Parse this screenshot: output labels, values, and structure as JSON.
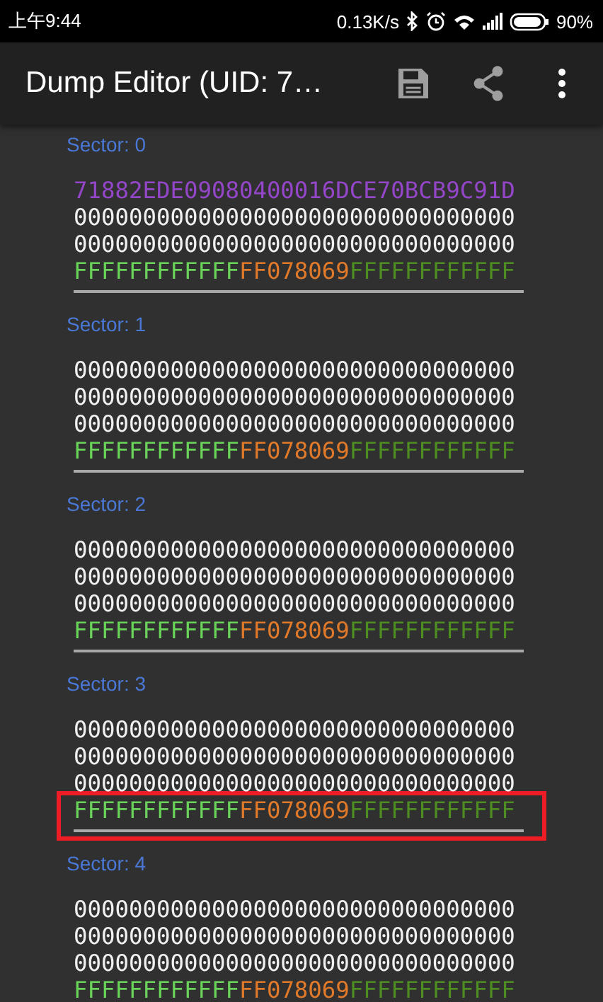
{
  "status_bar": {
    "time": "上午9:44",
    "network_speed": "0.13K/s",
    "battery": "90%"
  },
  "app_bar": {
    "title": "Dump Editor (UID: 7…"
  },
  "sectors": [
    {
      "label": "Sector: 0",
      "lines": [
        {
          "kind": "manufacturer",
          "text": "71882EDE09080400016DCE70BCB9C91D"
        },
        {
          "kind": "data",
          "text": "00000000000000000000000000000000"
        },
        {
          "kind": "data",
          "text": "00000000000000000000000000000000"
        },
        {
          "kind": "trailer",
          "key_a": "FFFFFFFFFFFF",
          "access_bits": "FF078069",
          "key_b": "FFFFFFFFFFFF",
          "highlighted": false
        }
      ]
    },
    {
      "label": "Sector: 1",
      "lines": [
        {
          "kind": "data",
          "text": "00000000000000000000000000000000"
        },
        {
          "kind": "data",
          "text": "00000000000000000000000000000000"
        },
        {
          "kind": "data",
          "text": "00000000000000000000000000000000"
        },
        {
          "kind": "trailer",
          "key_a": "FFFFFFFFFFFF",
          "access_bits": "FF078069",
          "key_b": "FFFFFFFFFFFF",
          "highlighted": false
        }
      ]
    },
    {
      "label": "Sector: 2",
      "lines": [
        {
          "kind": "data",
          "text": "00000000000000000000000000000000"
        },
        {
          "kind": "data",
          "text": "00000000000000000000000000000000"
        },
        {
          "kind": "data",
          "text": "00000000000000000000000000000000"
        },
        {
          "kind": "trailer",
          "key_a": "FFFFFFFFFFFF",
          "access_bits": "FF078069",
          "key_b": "FFFFFFFFFFFF",
          "highlighted": false
        }
      ]
    },
    {
      "label": "Sector: 3",
      "lines": [
        {
          "kind": "data",
          "text": "00000000000000000000000000000000"
        },
        {
          "kind": "data",
          "text": "00000000000000000000000000000000"
        },
        {
          "kind": "data",
          "text": "00000000000000000000000000000000"
        },
        {
          "kind": "trailer",
          "key_a": "FFFFFFFFFFFF",
          "access_bits": "FF078069",
          "key_b": "FFFFFFFFFFFF",
          "highlighted": true
        }
      ]
    },
    {
      "label": "Sector: 4",
      "lines": [
        {
          "kind": "data",
          "text": "00000000000000000000000000000000"
        },
        {
          "kind": "data",
          "text": "00000000000000000000000000000000"
        },
        {
          "kind": "data",
          "text": "00000000000000000000000000000000"
        },
        {
          "kind": "trailer",
          "key_a": "FFFFFFFFFFFF",
          "access_bits": "FF078069",
          "key_b": "FFFFFFFFFFFF",
          "highlighted": false
        }
      ]
    }
  ]
}
